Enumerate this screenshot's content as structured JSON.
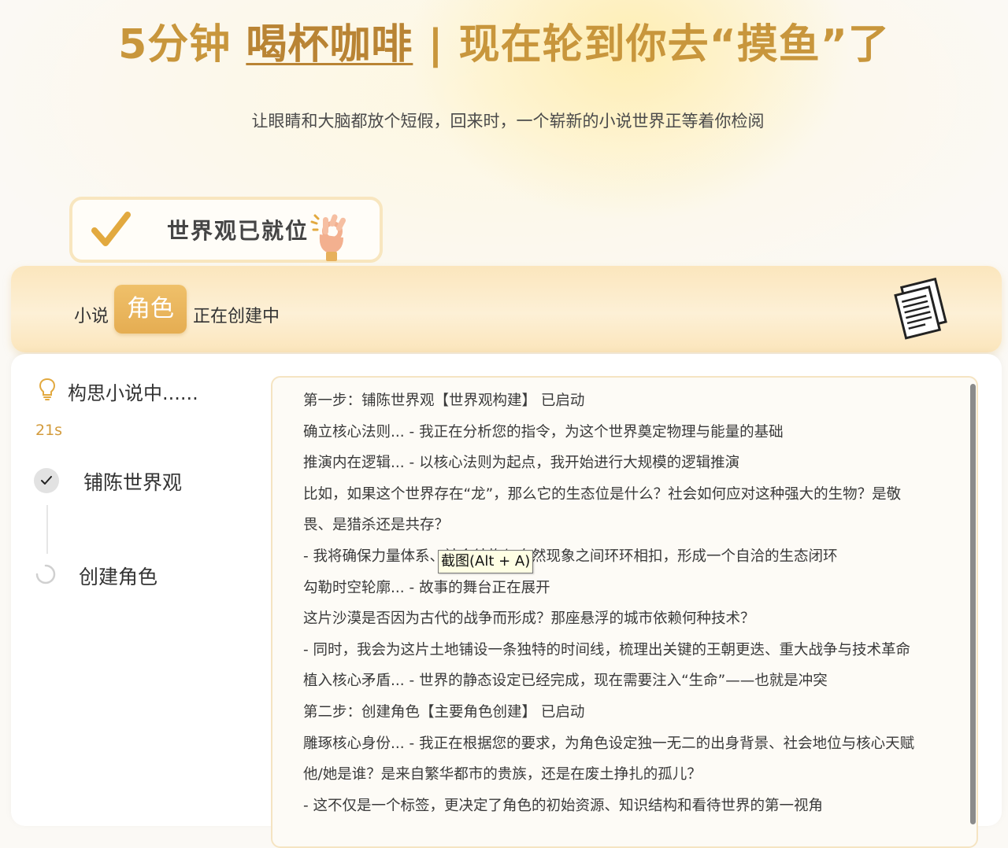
{
  "header": {
    "headline_prefix": "5分钟 ",
    "headline_highlight": "喝杯咖啡",
    "headline_suffix": " | 现在轮到你去“摸鱼”了",
    "subtitle": "让眼睛和大脑都放个短假，回来时，一个崭新的小说世界正等着你检阅"
  },
  "world_badge": {
    "label": "世界观已就位",
    "check_icon": "check-icon",
    "hand_icon": "ok-hand-icon"
  },
  "stage": {
    "prefix": "小说",
    "current": "角色",
    "suffix": "正在创建中",
    "icon": "document-stack-icon"
  },
  "progress": {
    "status": "构思小说中......",
    "elapsed": "21s",
    "steps": [
      {
        "label": "铺陈世界观",
        "state": "done"
      },
      {
        "label": "创建角色",
        "state": "loading"
      }
    ]
  },
  "log": {
    "lines": [
      "第一步：铺陈世界观【世界观构建】 已启动",
      "确立核心法则... - 我正在分析您的指令，为这个世界奠定物理与能量的基础",
      "推演内在逻辑... - 以核心法则为起点，我开始进行大规模的逻辑推演",
      "比如，如果这个世界存在“龙”，那么它的生态位是什么？社会如何应对这种强大的生物？是敬",
      "畏、是猎杀还是共存？",
      "- 我将确保力量体系、社会结构与自然现象之间环环相扣，形成一个自洽的生态闭环",
      "勾勒时空轮廓... - 故事的舞台正在展开",
      "这片沙漠是否因为古代的战争而形成？那座悬浮的城市依赖何种技术？",
      "- 同时，我会为这片土地铺设一条独特的时间线，梳理出关键的王朝更迭、重大战争与技术革命",
      "植入核心矛盾... - 世界的静态设定已经完成，现在需要注入“生命”——也就是冲突",
      "第二步：创建角色【主要角色创建】 已启动",
      "雕琢核心身份... - 我正在根据您的要求，为角色设定独一无二的出身背景、社会地位与核心天赋",
      "他/她是谁？是来自繁华都市的贵族，还是在废土挣扎的孤儿？",
      "- 这不仅是一个标签，更决定了角色的初始资源、知识结构和看待世界的第一视角"
    ]
  },
  "tooltip": {
    "text": "截图(Alt + A)"
  },
  "colors": {
    "accent": "#c8963c",
    "chip": "#e5ad52",
    "timer": "#d39b3c"
  }
}
